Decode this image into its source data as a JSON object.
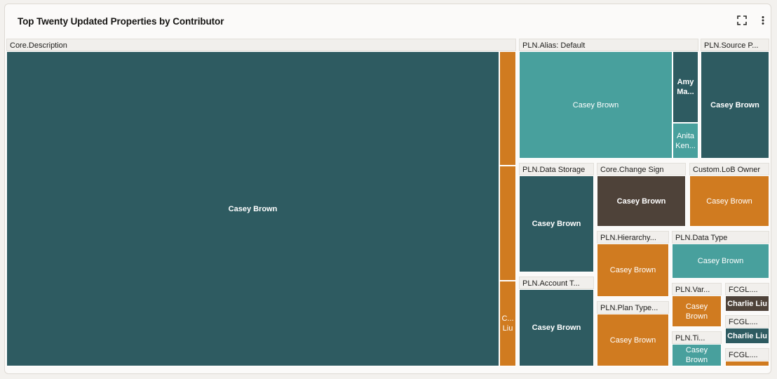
{
  "header": {
    "title": "Top Twenty Updated Properties by Contributor"
  },
  "icons": {
    "expand": "expand-icon",
    "more": "more-vertical-icon"
  },
  "colors": {
    "dark_teal": "#2e5b61",
    "light_teal": "#48a09d",
    "orange": "#d07b20",
    "dark_brown": "#4e4239",
    "header_bg": "#f1efec",
    "card_bg": "#fbfaf9"
  },
  "chart_data": {
    "type": "treemap",
    "title": "Top Twenty Updated Properties by Contributor",
    "groups": [
      {
        "name": "Core.Description",
        "label": "Core.Description",
        "children": [
          {
            "name": "Casey Brown",
            "label": "Casey Brown",
            "color": "#2e5b61"
          },
          {
            "name": "",
            "label": "",
            "color": "#d07b20"
          },
          {
            "name": "",
            "label": "",
            "color": "#d07b20"
          },
          {
            "name": "C... Liu",
            "label": "C... Liu",
            "color": "#d07b20"
          }
        ]
      },
      {
        "name": "PLN.Alias: Default",
        "label": "PLN.Alias: Default",
        "children": [
          {
            "name": "Casey Brown",
            "label": "Casey Brown",
            "color": "#48a09d"
          },
          {
            "name": "Amy Ma...",
            "label": "Amy Ma...",
            "color": "#2e5b61"
          },
          {
            "name": "Anita Ken...",
            "label": "Anita Ken...",
            "color": "#48a09d"
          }
        ]
      },
      {
        "name": "PLN.Source P...",
        "label": "PLN.Source P...",
        "children": [
          {
            "name": "Casey Brown",
            "label": "Casey Brown",
            "color": "#2e5b61"
          }
        ]
      },
      {
        "name": "PLN.Data Storage",
        "label": "PLN.Data Storage",
        "children": [
          {
            "name": "Casey Brown",
            "label": "Casey Brown",
            "color": "#2e5b61"
          }
        ]
      },
      {
        "name": "Core.Change Sign",
        "label": "Core.Change Sign",
        "children": [
          {
            "name": "Casey Brown",
            "label": "Casey Brown",
            "color": "#4e4239"
          }
        ]
      },
      {
        "name": "Custom.LoB Owner",
        "label": "Custom.LoB Owner",
        "children": [
          {
            "name": "Casey Brown",
            "label": "Casey Brown",
            "color": "#d07b20"
          }
        ]
      },
      {
        "name": "PLN.Account T...",
        "label": "PLN.Account T...",
        "children": [
          {
            "name": "Casey Brown",
            "label": "Casey Brown",
            "color": "#2e5b61"
          }
        ]
      },
      {
        "name": "PLN.Hierarchy...",
        "label": "PLN.Hierarchy...",
        "children": [
          {
            "name": "Casey Brown",
            "label": "Casey Brown",
            "color": "#d07b20"
          }
        ]
      },
      {
        "name": "PLN.Data Type",
        "label": "PLN.Data Type",
        "children": [
          {
            "name": "Casey Brown",
            "label": "Casey Brown",
            "color": "#48a09d"
          }
        ]
      },
      {
        "name": "PLN.Plan Type...",
        "label": "PLN.Plan Type...",
        "children": [
          {
            "name": "Casey Brown",
            "label": "Casey Brown",
            "color": "#d07b20"
          }
        ]
      },
      {
        "name": "PLN.Var...",
        "label": "PLN.Var...",
        "children": [
          {
            "name": "Casey Brown",
            "label": "Casey Brown",
            "color": "#d07b20"
          }
        ]
      },
      {
        "name": "PLN.Ti...",
        "label": "PLN.Ti...",
        "children": [
          {
            "name": "Casey Brown",
            "label": "Casey Brown",
            "color": "#48a09d"
          }
        ]
      },
      {
        "name": "FCGL....",
        "label": "FCGL....",
        "children": [
          {
            "name": "Charlie Liu",
            "label": "Charlie Liu",
            "color": "#4e4239"
          }
        ]
      },
      {
        "name": "FCGL....",
        "label": "FCGL....",
        "children": [
          {
            "name": "Charlie Liu",
            "label": "Charlie Liu",
            "color": "#2e5b61"
          }
        ]
      },
      {
        "name": "FCGL....",
        "label": "FCGL....",
        "children": [
          {
            "name": "",
            "label": "",
            "color": "#d07b20"
          }
        ]
      }
    ]
  }
}
